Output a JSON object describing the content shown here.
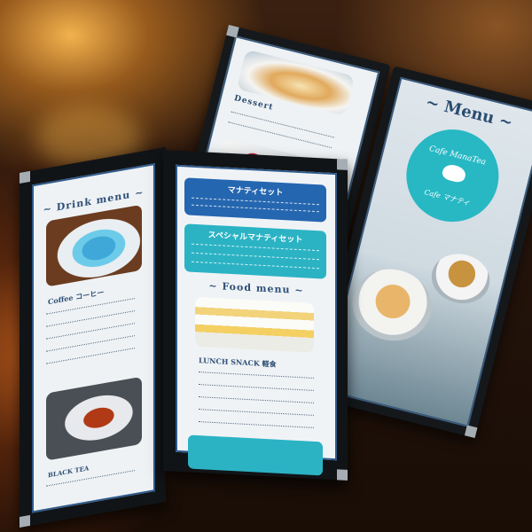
{
  "back_menu": {
    "dessert_title": "Dessert",
    "menu_title": "~ Menu ~",
    "logo": {
      "line1": "Cafe ManaTea",
      "line2": "Cafe マナティ"
    }
  },
  "front_menu": {
    "drink_title": "~ Drink menu ~",
    "coffee_label": "Coffee コーヒー",
    "tea_label": "BLACK TEA",
    "set1_title": "マナティセット",
    "set2_title": "スペシャルマナティセット",
    "food_title": "~ Food menu ~",
    "lunch_label": "LUNCH SNACK 軽食"
  },
  "colors": {
    "accent_navy": "#2e4f76",
    "accent_teal": "#2bb3c4",
    "accent_blue": "#2566b0"
  }
}
